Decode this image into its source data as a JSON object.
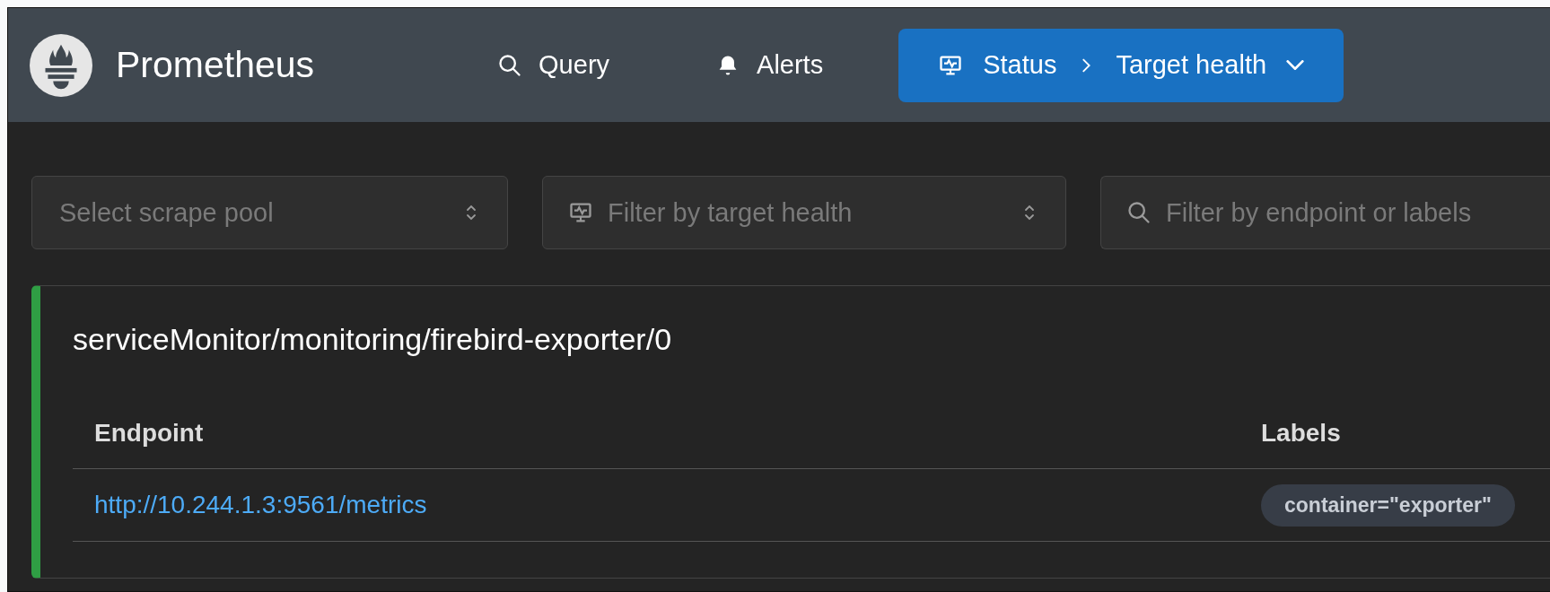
{
  "header": {
    "brand": "Prometheus",
    "nav": [
      {
        "kind": "search",
        "label": "Query",
        "selected": false
      },
      {
        "kind": "bell",
        "label": "Alerts",
        "selected": false
      },
      {
        "kind": "monitor",
        "label": "Status",
        "sub": "Target health",
        "selected": true
      }
    ]
  },
  "filters": [
    {
      "kind": "select",
      "placeholder": "Select scrape pool"
    },
    {
      "kind": "health",
      "placeholder": "Filter by target health"
    },
    {
      "kind": "search",
      "placeholder": "Filter by endpoint or labels"
    }
  ],
  "pools": [
    {
      "title": "serviceMonitor/monitoring/firebird-exporter/0",
      "color": "#2f9e44",
      "columns": [
        "Endpoint",
        "Labels"
      ],
      "rows": [
        {
          "endpoint": "http://10.244.1.3:9561/metrics",
          "labels": [
            "container=\"exporter\""
          ]
        }
      ]
    }
  ]
}
